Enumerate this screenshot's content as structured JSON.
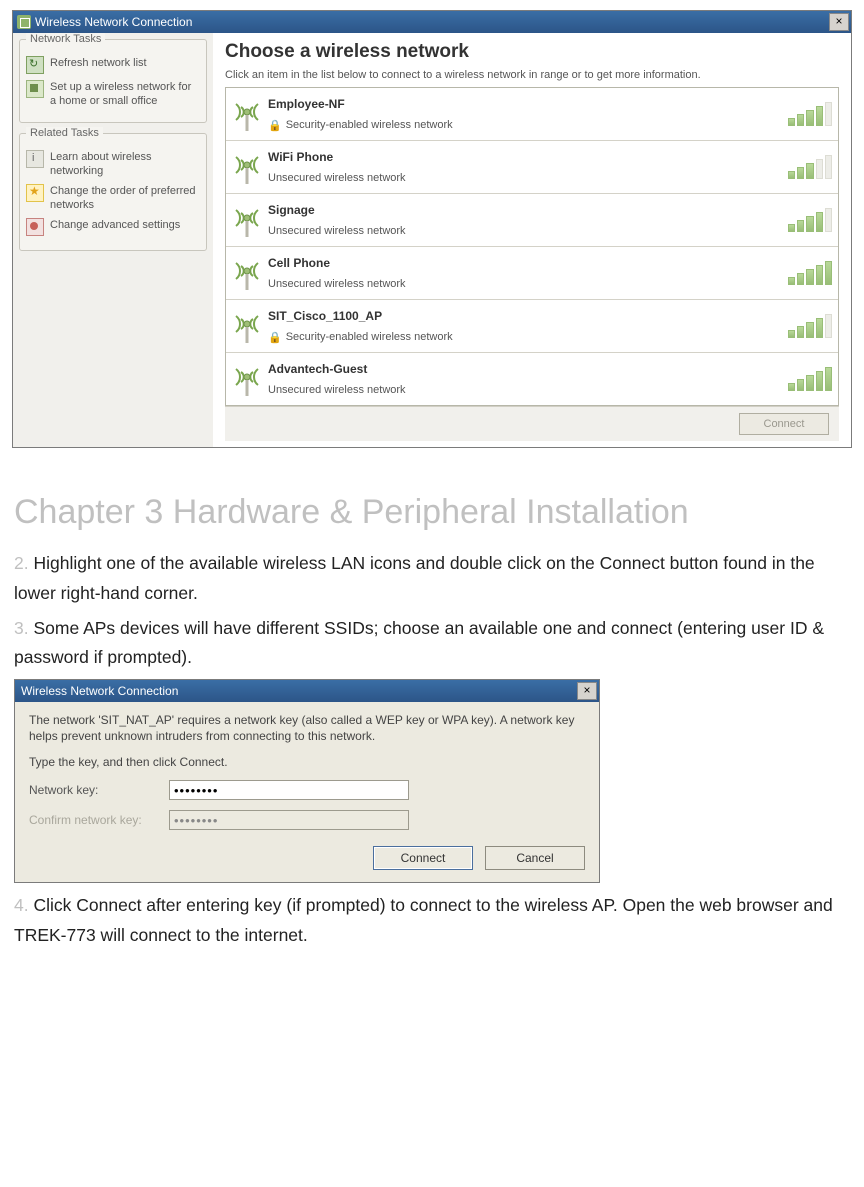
{
  "dlg1": {
    "title": "Wireless Network Connection",
    "left": {
      "group1_title": "Network Tasks",
      "refresh": "Refresh network list",
      "setup": "Set up a wireless network for a home or small office",
      "group2_title": "Related Tasks",
      "learn": "Learn about wireless networking",
      "order": "Change the order of preferred networks",
      "advanced": "Change advanced settings"
    },
    "right": {
      "heading": "Choose a wireless network",
      "subtext": "Click an item in the list below to connect to a wireless network in range or to get more information."
    },
    "networks": [
      {
        "name": "Employee-NF",
        "status": "Security-enabled wireless network",
        "secured": true,
        "signal": 4
      },
      {
        "name": "WiFi Phone",
        "status": "Unsecured wireless network",
        "secured": false,
        "signal": 3
      },
      {
        "name": "Signage",
        "status": "Unsecured wireless network",
        "secured": false,
        "signal": 4
      },
      {
        "name": "Cell Phone",
        "status": "Unsecured wireless network",
        "secured": false,
        "signal": 5
      },
      {
        "name": "SIT_Cisco_1100_AP",
        "status": "Security-enabled wireless network",
        "secured": true,
        "signal": 4
      },
      {
        "name": "Advantech-Guest",
        "status": "Unsecured wireless network",
        "secured": false,
        "signal": 5
      }
    ],
    "connect_btn": "Connect"
  },
  "doc": {
    "chapter_title": "Chapter 3 Hardware & Peripheral Installation",
    "step2_num": "2.",
    "step2": " Highlight one of the available wireless LAN icons and double click on the Connect button found in the lower right-hand corner.",
    "step3_num": "3.",
    "step3": " Some APs devices will have different SSIDs; choose an available one and connect (entering user ID & password if prompted).",
    "step4_num": "4.",
    "step4": " Click Connect after entering key (if prompted) to connect to the wireless AP. Open the web browser and TREK-773 will connect to the internet."
  },
  "dlg2": {
    "title": "Wireless Network Connection",
    "p1": "The network 'SIT_NAT_AP' requires a network key (also called a WEP key or WPA key). A network key helps prevent unknown intruders from connecting to this network.",
    "p2": "Type the key, and then click Connect.",
    "key_label": "Network key:",
    "key_value": "••••••••",
    "confirm_label": "Confirm network key:",
    "confirm_value": "••••••••",
    "connect": "Connect",
    "cancel": "Cancel"
  }
}
